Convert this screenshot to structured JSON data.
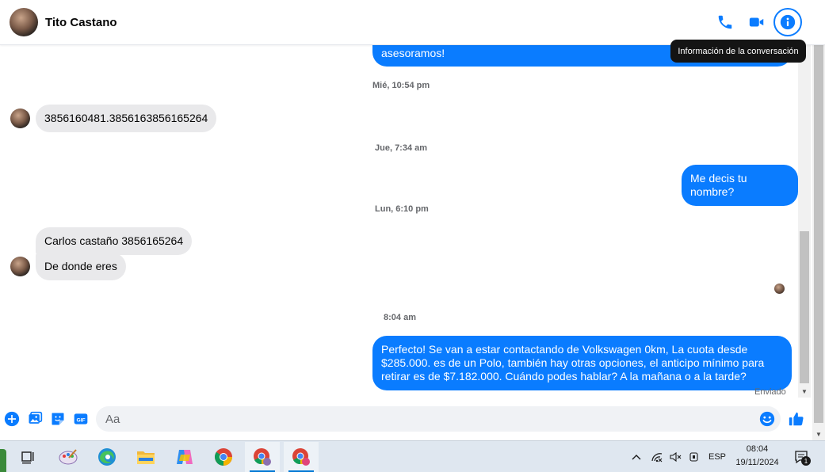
{
  "header": {
    "contact_name": "Tito Castano",
    "tooltip": "Información de la conversación"
  },
  "messages": {
    "top_partial": "asesoramos!",
    "ts1": "Mié, 10:54 pm",
    "msg_in_1": "3856160481.3856163856165264",
    "ts2": "Jue, 7:34 am",
    "msg_out_1": "Me decis tu nombre?",
    "ts3": "Lun, 6:10 pm",
    "msg_in_2": "Carlos castaño 3856165264",
    "msg_in_3": "De donde eres",
    "ts4": "8:04 am",
    "msg_out_2": "Perfecto!  Se van a estar contactando de Volkswagen 0km, La cuota desde $285.000. es de un Polo, también hay otras opciones, el anticipo mínimo para retirar es de $7.182.000. Cuándo podes hablar? A la mañana o a la tarde?",
    "status": "Enviado"
  },
  "composer": {
    "placeholder": "Aa"
  },
  "taskbar": {
    "lang": "ESP",
    "time": "08:04",
    "date": "19/11/2024",
    "notif_count": "1"
  },
  "colors": {
    "accent": "#0a7cff",
    "incoming_bubble": "#e9e9eb",
    "taskbar": "#dfe7f0"
  }
}
